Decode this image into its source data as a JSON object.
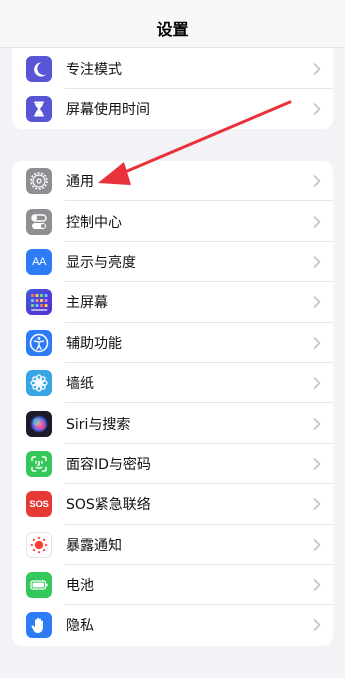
{
  "nav": {
    "title": "设置"
  },
  "group_top": [
    {
      "label": "专注模式",
      "icon": "moon-icon",
      "color": "#5856d6",
      "name": "row-focus"
    },
    {
      "label": "屏幕使用时间",
      "icon": "hourglass-icon",
      "color": "#5856d6",
      "name": "row-screen-time"
    }
  ],
  "group_main": [
    {
      "label": "通用",
      "icon": "gear-icon",
      "color": "#8e8e93",
      "name": "row-general"
    },
    {
      "label": "控制中心",
      "icon": "toggles-icon",
      "color": "#8e8e93",
      "name": "row-control-center"
    },
    {
      "label": "显示与亮度",
      "icon": "text-size-icon",
      "color": "#2d7cf6",
      "name": "row-display"
    },
    {
      "label": "主屏幕",
      "icon": "home-grid-icon",
      "color": "#3a47d6",
      "name": "row-home-screen"
    },
    {
      "label": "辅助功能",
      "icon": "accessibility-icon",
      "color": "#2d7cf6",
      "name": "row-accessibility"
    },
    {
      "label": "墙纸",
      "icon": "flower-icon",
      "color": "#38a5e5",
      "name": "row-wallpaper"
    },
    {
      "label": "Siri与搜索",
      "icon": "siri-icon",
      "color": "#1b1b2a",
      "name": "row-siri"
    },
    {
      "label": "面容ID与密码",
      "icon": "face-id-icon",
      "color": "#34c759",
      "name": "row-face-id"
    },
    {
      "label": "SOS紧急联络",
      "icon": "sos-icon",
      "color": "#e53935",
      "name": "row-sos"
    },
    {
      "label": "暴露通知",
      "icon": "exposure-icon",
      "color": "#ffffff",
      "name": "row-exposure"
    },
    {
      "label": "电池",
      "icon": "battery-icon",
      "color": "#34c759",
      "name": "row-battery"
    },
    {
      "label": "隐私",
      "icon": "hand-icon",
      "color": "#2d7cf6",
      "name": "row-privacy"
    }
  ],
  "sos_text": "SOS",
  "aa_text": "AA",
  "annotation": {
    "color": "#e8313a",
    "icon": "red-arrow-annotation"
  }
}
